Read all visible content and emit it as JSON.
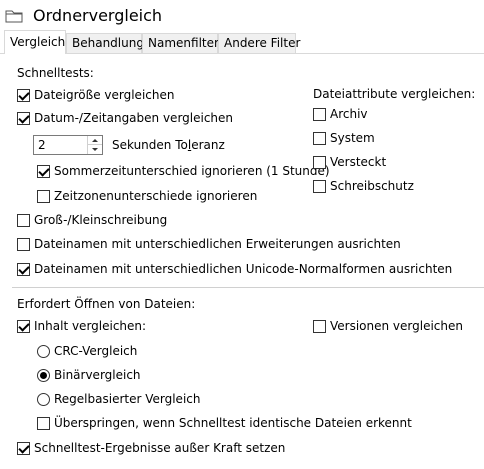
{
  "window": {
    "title": "Ordnervergleich"
  },
  "tabs": [
    "Vergleich",
    "Behandlung",
    "Namenfilter",
    "Andere Filter"
  ],
  "quick_tests": {
    "heading": "Schnelltests:",
    "compare_size": {
      "label": "Dateigröße vergleichen",
      "checked": true
    },
    "compare_datetime": {
      "label": "Datum-/Zeitangaben vergleichen",
      "checked": true
    },
    "tolerance": {
      "value": "2",
      "label_before": "Sekunden To",
      "label_underlined": "l",
      "label_after": "eranz"
    },
    "ignore_dst": {
      "label": "Sommerzeitunterschied ignorieren (1 Stunde)",
      "checked": true
    },
    "ignore_timezone": {
      "label": "Zeitzonenunterschiede ignorieren",
      "checked": false
    },
    "case_sensitive": {
      "label": "Groß-/Kleinschreibung",
      "checked": false
    },
    "align_extensions": {
      "label": "Dateinamen mit unterschiedlichen Erweiterungen ausrichten",
      "checked": false
    },
    "align_unicode": {
      "label": "Dateinamen mit unterschiedlichen Unicode-Normalformen ausrichten",
      "checked": true
    }
  },
  "attributes": {
    "heading": "Dateiattribute vergleichen:",
    "archive": {
      "label": "Archiv",
      "checked": false
    },
    "system": {
      "label": "System",
      "checked": false
    },
    "hidden": {
      "label": "Versteckt",
      "checked": false
    },
    "readonly": {
      "label": "Schreibschutz",
      "checked": false
    }
  },
  "file_open": {
    "heading": "Erfordert Öffnen von Dateien:",
    "compare_content": {
      "label": "Inhalt vergleichen:",
      "checked": true
    },
    "compare_versions": {
      "label": "Versionen vergleichen",
      "checked": false
    },
    "crc": {
      "label": "CRC-Vergleich",
      "selected": false
    },
    "binary": {
      "label": "Binärvergleich",
      "selected": true
    },
    "rule_based": {
      "label": "Regelbasierter Vergleich",
      "selected": false
    },
    "skip_identical": {
      "label": "Überspringen, wenn Schnelltest identische Dateien erkennt",
      "checked": false
    },
    "override_results": {
      "label": "Schnelltest-Ergebnisse außer Kraft setzen",
      "checked": true
    }
  }
}
